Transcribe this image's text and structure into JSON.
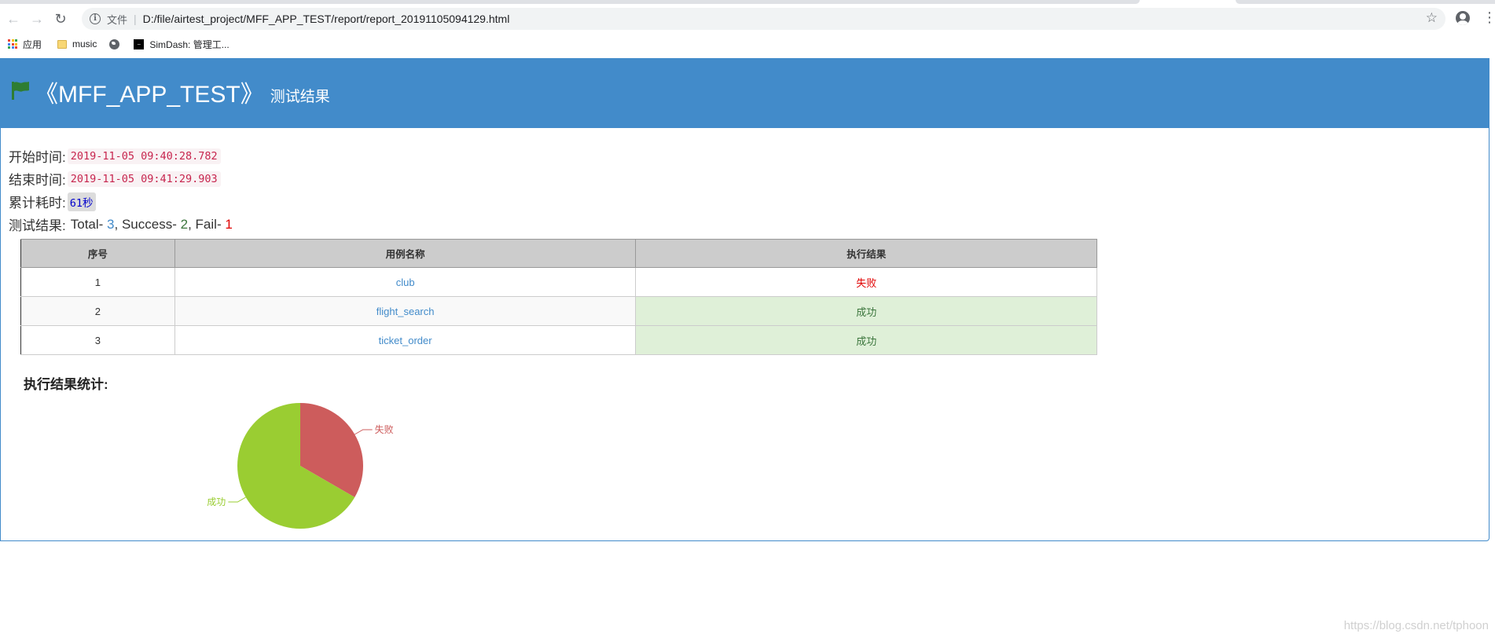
{
  "browser": {
    "omnibox": {
      "scheme_label": "文件",
      "separator": "|",
      "url": "D:/file/airtest_project/MFF_APP_TEST/report/report_20191105094129.html"
    },
    "bookmarks": [
      {
        "label": "应用",
        "icon": "apps-icon"
      },
      {
        "label": "music",
        "icon": "folder-icon"
      },
      {
        "label": "",
        "icon": "globe-icon"
      },
      {
        "label": "SimDash: 管理工...",
        "icon": "simdash-icon"
      }
    ]
  },
  "report": {
    "title": "《MFF_APP_TEST》",
    "subtitle": "测试结果",
    "start_label": "开始时间:",
    "start_time": "2019-11-05 09:40:28.782",
    "end_label": "结束时间:",
    "end_time": "2019-11-05 09:41:29.903",
    "duration_label": "累计耗时:",
    "duration": "61秒",
    "result_label": "测试结果:",
    "total_label": "Total-",
    "total": "3",
    "success_label": "Success-",
    "success": "2",
    "fail_label": "Fail-",
    "fail": "1",
    "table": {
      "headers": [
        "序号",
        "用例名称",
        "执行结果"
      ],
      "rows": [
        {
          "index": "1",
          "name": "club",
          "result": "失败",
          "status": "fail"
        },
        {
          "index": "2",
          "name": "flight_search",
          "result": "成功",
          "status": "pass"
        },
        {
          "index": "3",
          "name": "ticket_order",
          "result": "成功",
          "status": "pass"
        }
      ]
    },
    "stats_title": "执行结果统计:"
  },
  "chart_data": {
    "type": "pie",
    "slices": [
      {
        "label": "失败",
        "value": 1,
        "color": "#cd5c5c"
      },
      {
        "label": "成功",
        "value": 2,
        "color": "#9acd32"
      }
    ]
  },
  "colors": {
    "header_bg": "#428bca",
    "flag": "#2e7d32",
    "fail": "#e00000",
    "pass": "#3c763d",
    "pass_bg": "#dff0d8"
  },
  "watermark": "https://blog.csdn.net/tphoon"
}
